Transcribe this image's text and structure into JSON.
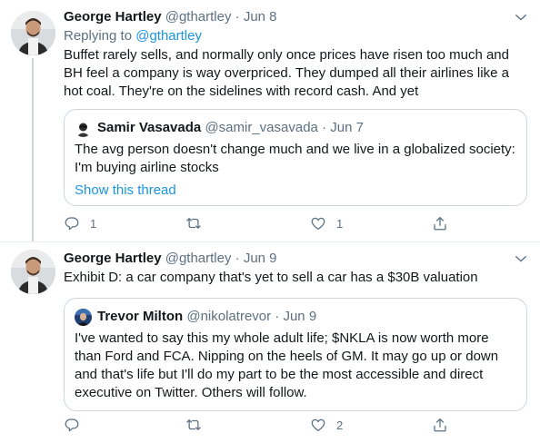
{
  "tweets": [
    {
      "author_name": "George Hartley",
      "author_handle": "@gthartley",
      "separator": "·",
      "date": "Jun 8",
      "replying_prefix": "Replying to",
      "replying_handle": "@gthartley",
      "text": "Buffet rarely sells, and normally only once prices have risen too much and BH feel a company is way overpriced. They dumped all their airlines like a hot coal. They're on the sidelines with record cash. And yet",
      "quote": {
        "author_name": "Samir Vasavada",
        "author_handle": "@samir_vasavada",
        "date": "Jun 7",
        "text": "The avg person doesn't change much and we live in a globalized society: I'm buying airline stocks",
        "show_thread": "Show this thread"
      },
      "actions": {
        "reply_count": "1",
        "retweet_count": "",
        "like_count": "1"
      }
    },
    {
      "author_name": "George Hartley",
      "author_handle": "@gthartley",
      "separator": "·",
      "date": "Jun 9",
      "text": "Exhibit D: a car company that's yet to sell a car has a $30B valuation",
      "quote": {
        "author_name": "Trevor Milton",
        "author_handle": "@nikolatrevor",
        "date": "Jun 9",
        "text": "I've wanted to say this my whole adult life; $NKLA is now worth more than Ford and FCA. Nipping on the heels of GM. It may go up or down and that's life but I'll do my part to be the most accessible and direct executive on Twitter. Others will follow."
      },
      "actions": {
        "reply_count": "",
        "retweet_count": "",
        "like_count": "2"
      }
    }
  ],
  "icons": {
    "reply": "reply-icon",
    "retweet": "retweet-icon",
    "like": "heart-icon",
    "share": "share-icon",
    "more": "chevron-down-icon"
  },
  "colors": {
    "link": "#1b95e0",
    "muted": "#5b7083",
    "border": "#ccd6dd",
    "text": "#14171a"
  }
}
